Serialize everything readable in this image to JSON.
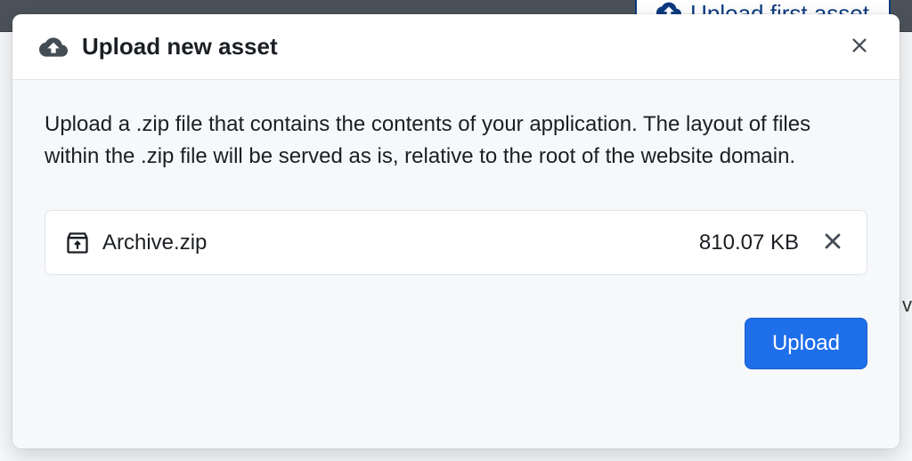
{
  "backdrop": {
    "upload_first_label": "Upload first asset",
    "partial_text": "v"
  },
  "modal": {
    "title": "Upload new asset",
    "instructions": "Upload a .zip file that contains the contents of your application. The layout of files within the .zip file will be served as is, relative to the root of the website domain.",
    "file": {
      "name": "Archive.zip",
      "size": "810.07 KB"
    },
    "upload_label": "Upload"
  }
}
